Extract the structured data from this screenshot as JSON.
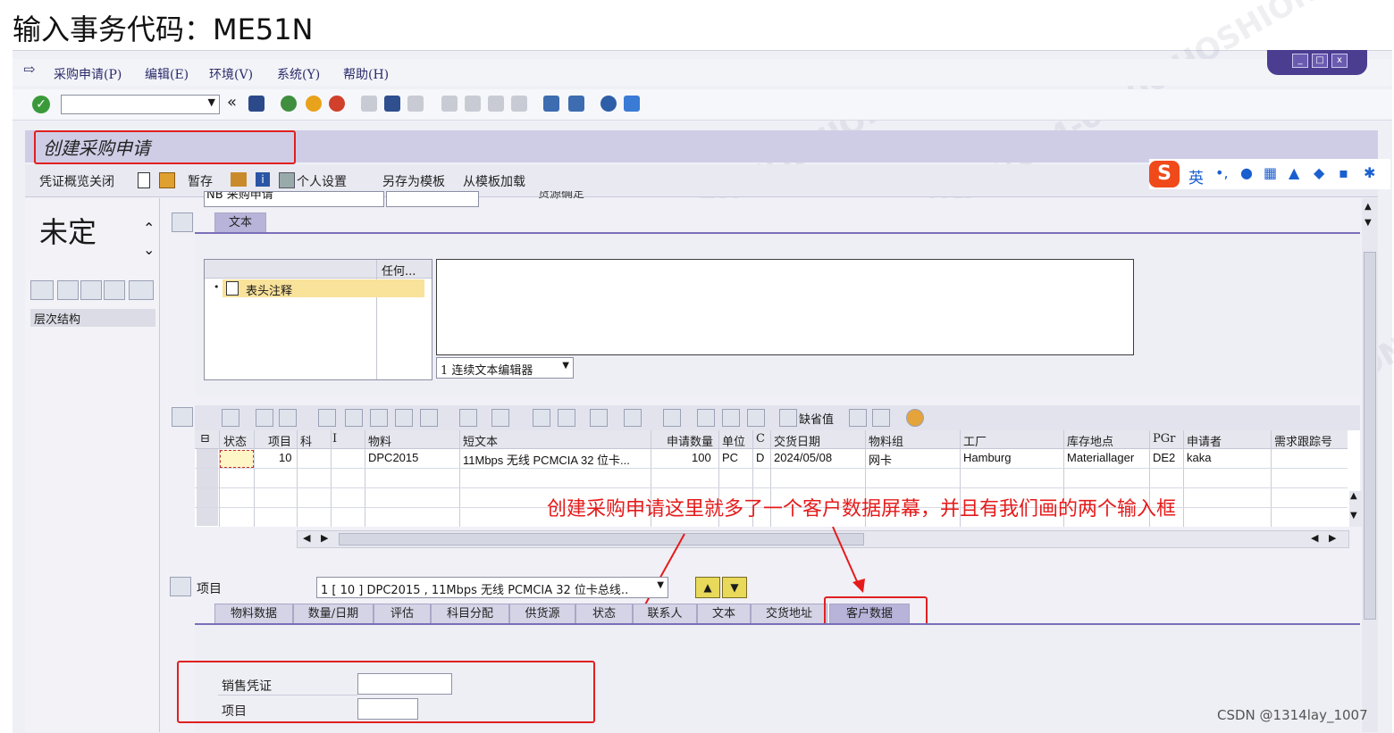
{
  "caption": "输入事务代码：ME51N",
  "menu": {
    "items": [
      "采购申请(P)",
      "编辑(E)",
      "环境(V)",
      "系统(Y)",
      "帮助(H)"
    ]
  },
  "window_controls": [
    "_",
    "□",
    "x"
  ],
  "toolbar": {
    "command_field": "",
    "chevron": "«"
  },
  "title": "创建采购申请",
  "app_toolbar": {
    "close_overview": "凭证概览关闭",
    "hold": "暂存",
    "personal_settings": "个人设置",
    "save_as_template": "另存为模板",
    "load_from_template": "从模板加载"
  },
  "ime_bar": {
    "lang": "英"
  },
  "left_pane": {
    "status_text": "未定义变",
    "hierarchy": "层次结构"
  },
  "header_partial": {
    "doc_type": "NB 采购申请",
    "source": "货源确定"
  },
  "header": {
    "tab_text": "文本",
    "text_col_header": "任何...",
    "text_item": "表头注释",
    "editor_select": "1 连续文本编辑器"
  },
  "grid": {
    "toolbar_shortage": "缺省值",
    "columns": [
      "状态",
      "项目",
      "科",
      "I",
      "物料",
      "短文本",
      "申请数量",
      "单位",
      "C",
      "交货日期",
      "物料组",
      "工厂",
      "库存地点",
      "PGr",
      "申请者",
      "需求跟踪号"
    ],
    "rows": [
      {
        "status": "",
        "item": "10",
        "acct": "",
        "i": "",
        "material": "DPC2015",
        "short_text": "11Mbps 无线 PCMCIA 32 位卡...",
        "qty": "100",
        "unit": "PC",
        "c": "D",
        "delivery": "2024/05/08",
        "matl_group": "网卡",
        "plant": "Hamburg",
        "sloc": "Materiallager",
        "pgr": "DE2",
        "requester": "kaka",
        "tracking": ""
      }
    ]
  },
  "annotation": "创建采购申请这里就多了一个客户数据屏幕，并且有我们画的两个输入框",
  "item_detail": {
    "label": "项目",
    "select": "1 [ 10 ] DPC2015 , 11Mbps 无线 PCMCIA 32 位卡总线..",
    "tabs": [
      "物料数据",
      "数量/日期",
      "评估",
      "科目分配",
      "供货源",
      "状态",
      "联系人",
      "文本",
      "交货地址",
      "客户数据"
    ],
    "active_tab": "客户数据",
    "fields": [
      {
        "label": "销售凭证",
        "value": ""
      },
      {
        "label": "项目",
        "value": ""
      }
    ]
  },
  "watermark": "0FB2F242 2024-05-06 HOSHION",
  "footer_credit": "CSDN @1314lay_1007",
  "colors": {
    "accent": "#7a6fb8",
    "annotation": "#e51b1b",
    "title_bar": "#cfcde6",
    "selected_cell": "#fff6c8"
  }
}
